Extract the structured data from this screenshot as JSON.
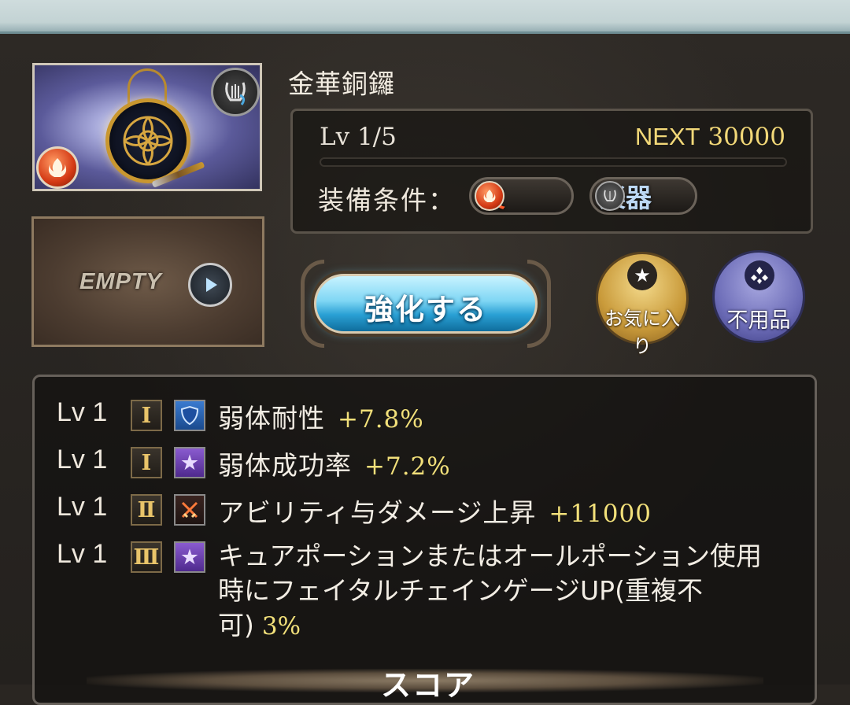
{
  "weapon": {
    "name": "金華銅鑼",
    "level": "Lv 1/5",
    "next_label": "NEXT",
    "next_value": "30000",
    "exp_fill_percent": 0
  },
  "equip": {
    "label": "装備条件：",
    "element": "火",
    "weapon_type": "楽器"
  },
  "summon_slot": {
    "label": "EMPTY"
  },
  "actions": {
    "upgrade": "強化する",
    "favorite": "お気に入り",
    "junk": "不用品"
  },
  "skills": [
    {
      "lv": "Lv 1",
      "rank": "Ⅰ",
      "icon": "shield-icon",
      "name": "弱体耐性",
      "value": "+7.8%"
    },
    {
      "lv": "Lv 1",
      "rank": "Ⅰ",
      "icon": "star-icon",
      "name": "弱体成功率",
      "value": "+7.2%"
    },
    {
      "lv": "Lv 1",
      "rank": "Ⅱ",
      "icon": "crossed-swords-icon",
      "name": "アビリティ与ダメージ上昇",
      "value": "+11000"
    },
    {
      "lv": "Lv 1",
      "rank": "Ⅲ",
      "icon": "star-icon",
      "name": "キュアポーションまたはオールポーション使用時にフェイタルチェインゲージUP(重複不可)",
      "value": "3%"
    }
  ],
  "score_label": "スコア",
  "colors": {
    "accent_gold": "#f2e07a",
    "fire": "#ff5a2a",
    "instrument": "#bcd8f4",
    "upgrade_blue": "#2aa0d4"
  }
}
